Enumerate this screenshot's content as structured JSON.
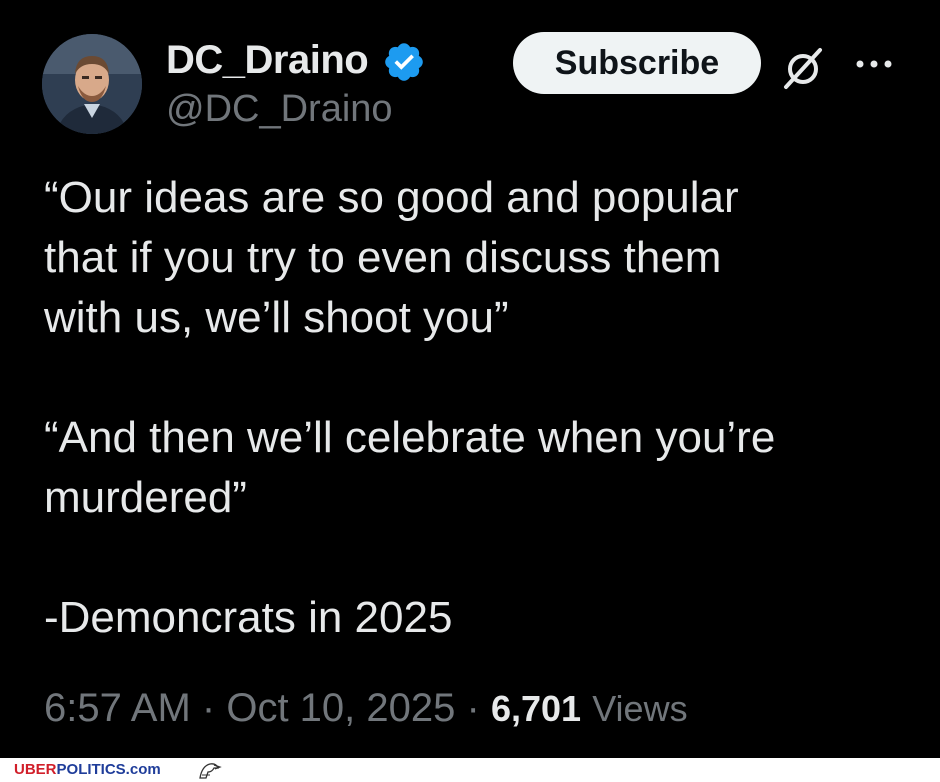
{
  "tweet": {
    "display_name": "DC_Draino",
    "handle": "@DC_Draino",
    "subscribe_label": "Subscribe",
    "body_lines": [
      "“Our ideas are so good and popular",
      "that if you try to even discuss them",
      "with us, we’ll shoot you”",
      "",
      "“And then we’ll celebrate when you’re",
      "murdered”",
      "",
      "-Demoncrats in 2025"
    ],
    "time": "6:57 AM",
    "separator": "·",
    "date": "Oct 10, 2025",
    "views_count": "6,701",
    "views_label": "Views"
  },
  "watermark": {
    "part1": "UBER",
    "part2": "POLITICS.com"
  },
  "icons": {
    "verified": "verified-badge-icon",
    "grok": "grok-icon",
    "more": "more-options-icon",
    "watermark_logo": "eagle-icon"
  },
  "colors": {
    "background": "#000000",
    "text": "#e7e9ea",
    "secondary_text": "#71767b",
    "verified_blue": "#1d9bf0",
    "subscribe_bg": "#eff3f4",
    "watermark_red": "#d11f2a",
    "watermark_blue": "#1f3d9a"
  }
}
